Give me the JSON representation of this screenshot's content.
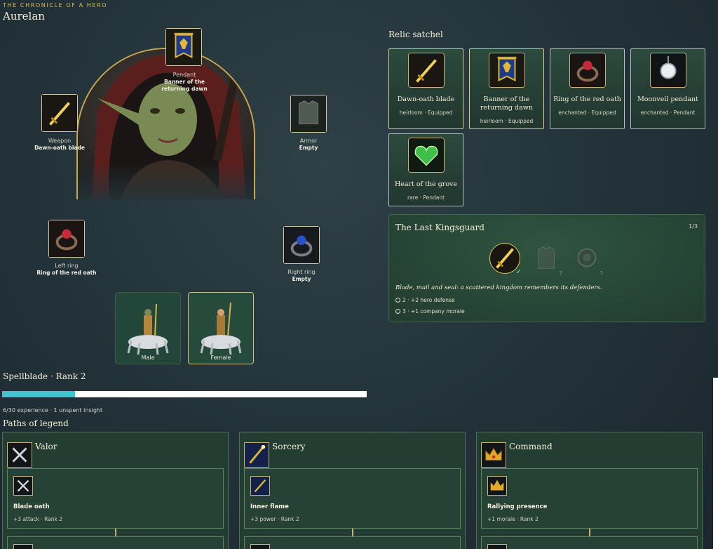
{
  "header": {
    "kicker": "THE CHRONICLE OF A HERO",
    "hero_name": "Aurelan"
  },
  "slots": {
    "pendant": {
      "label": "Pendant",
      "item": "Banner of the returning dawn"
    },
    "weapon": {
      "label": "Weapon",
      "item": "Dawn-oath blade"
    },
    "armor": {
      "label": "Armor",
      "item": "Empty"
    },
    "left_ring": {
      "label": "Left ring",
      "item": "Ring of the red oath"
    },
    "right_ring": {
      "label": "Right ring",
      "item": "Empty"
    }
  },
  "mounts": [
    {
      "label": "Male",
      "selected": false
    },
    {
      "label": "Female",
      "selected": true
    }
  ],
  "progress": {
    "title": "Spellblade · Rank 2",
    "xp_current": 6,
    "xp_max": 30,
    "text": "6/30 experience · 1 unspent insight"
  },
  "paths": {
    "title": "Paths of legend",
    "items": [
      {
        "name": "Valor",
        "icon": "crossed-swords-icon",
        "node_title": "Blade oath",
        "node_sub": "+3 attack · Rank 2"
      },
      {
        "name": "Sorcery",
        "icon": "magic-staff-icon",
        "node_title": "Inner flame",
        "node_sub": "+3 power · Rank 2"
      },
      {
        "name": "Command",
        "icon": "crown-icon",
        "node_title": "Rallying presence",
        "node_sub": "+1 morale · Rank 2"
      }
    ]
  },
  "satchel": {
    "title": "Relic satchel",
    "items": [
      {
        "name": "Dawn-oath blade",
        "meta": "heirloom · Equipped",
        "icon": "golden-sword-icon",
        "equipped": true
      },
      {
        "name": "Banner of the returning dawn",
        "meta": "heirloom · Equipped",
        "icon": "banner-icon",
        "equipped": true
      },
      {
        "name": "Ring of the red oath",
        "meta": "enchanted · Equipped",
        "icon": "ruby-ring-icon",
        "equipped": true
      },
      {
        "name": "Moonveil pendant",
        "meta": "enchanted · Pendant",
        "icon": "moon-pendant-icon",
        "equipped": false
      },
      {
        "name": "Heart of the grove",
        "meta": "rare · Pendant",
        "icon": "heart-amulet-icon",
        "equipped": false
      }
    ]
  },
  "set": {
    "title": "The Last Kingsguard",
    "count": "1/3",
    "desc": "Blade, mail and seal: a scattered kingdom remembers its defenders.",
    "pieces": [
      {
        "icon": "golden-sword-icon",
        "owned": true,
        "mark": "✓"
      },
      {
        "icon": "armor-icon",
        "owned": false,
        "mark": "?"
      },
      {
        "icon": "seal-ring-icon",
        "owned": false,
        "mark": "?"
      }
    ],
    "bonuses": [
      {
        "text": "2 · +2 hero defense"
      },
      {
        "text": "3 · +1 company morale"
      }
    ]
  },
  "colors": {
    "accent_gold": "#c9a84c",
    "xp_fill": "#3ec6cf",
    "panel_green": "#233d33"
  }
}
